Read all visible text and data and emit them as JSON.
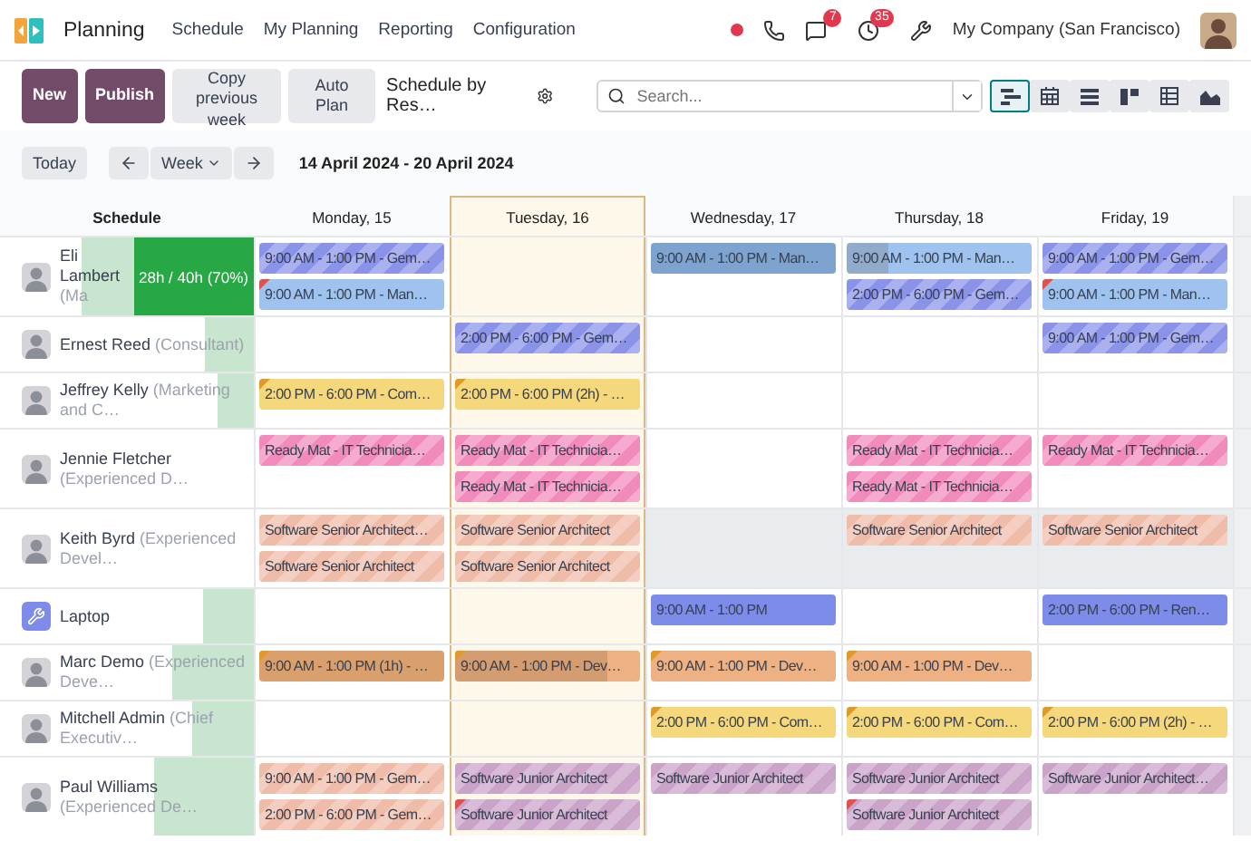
{
  "navbar": {
    "app_name": "Planning",
    "menu": [
      "Schedule",
      "My Planning",
      "Reporting",
      "Configuration"
    ],
    "chat_badge": "7",
    "activity_badge": "35",
    "company": "My Company (San Francisco)"
  },
  "toolbar": {
    "buttons": [
      {
        "label": "New",
        "kind": "primary"
      },
      {
        "label": "Publish",
        "kind": "primary"
      },
      {
        "label": "Copy previous week",
        "kind": "secondary"
      },
      {
        "label": "Auto Plan",
        "kind": "secondary"
      }
    ],
    "view_title": "Schedule by Res…",
    "search": {
      "placeholder": "Search..."
    },
    "views": [
      {
        "kind": "gantt",
        "selected": true
      },
      {
        "kind": "calendar",
        "selected": false
      },
      {
        "kind": "list",
        "selected": false
      },
      {
        "kind": "kanban",
        "selected": false
      },
      {
        "kind": "pivot",
        "selected": false
      },
      {
        "kind": "graph",
        "selected": false
      }
    ]
  },
  "date_bar": {
    "today": "Today",
    "scale": "Week",
    "range": "14 April 2024 - 20 April 2024"
  },
  "gantt": {
    "row_header": "Schedule",
    "days": [
      {
        "label": "Monday, 15",
        "today": false
      },
      {
        "label": "Tuesday, 16",
        "today": true
      },
      {
        "label": "Wednesday, 17",
        "today": false
      },
      {
        "label": "Thursday, 18",
        "today": false
      },
      {
        "label": "Friday, 19",
        "today": false
      }
    ],
    "rows": [
      {
        "name": "Eli Lambert",
        "role": "(Ma",
        "kind": "person",
        "level": 0.68,
        "workload": "28h / 40h (70%)",
        "cells": [
          {
            "unavailable": false,
            "pills": [
              {
                "text": "9:00 AM - 1:00 PM - Gem…",
                "color": "#8a93e8",
                "striped": true
              },
              {
                "text": "9:00 AM - 1:00 PM - Man…",
                "color": "#9fc3ee",
                "striped": false,
                "corner": {
                  "color": "#e0524f"
                }
              }
            ]
          },
          {
            "unavailable": false
          },
          {
            "unavailable": false,
            "pills": [
              {
                "text": "9:00 AM - 1:00 PM - Man…",
                "color": "#7fa3cf",
                "striped": false
              }
            ]
          },
          {
            "unavailable": false,
            "pills": [
              {
                "text": "9:00 AM - 1:00 PM - Man…",
                "color": "#9fc3ee",
                "striped": false,
                "level": 0.23
              },
              {
                "text": "2:00 PM - 6:00 PM - Gem…",
                "color": "#8a93e8",
                "striped": true
              }
            ]
          },
          {
            "unavailable": false,
            "pills": [
              {
                "text": "9:00 AM - 1:00 PM - Gem…",
                "color": "#8a93e8",
                "striped": true
              },
              {
                "text": "9:00 AM - 1:00 PM - Man…",
                "color": "#9fc3ee",
                "striped": false,
                "corner": {
                  "color": "#e0524f"
                }
              }
            ]
          }
        ]
      },
      {
        "name": "Ernest Reed",
        "role": "(Consultant)",
        "kind": "person",
        "level": 0.19,
        "cells": [
          {
            "unavailable": false
          },
          {
            "unavailable": false,
            "pills": [
              {
                "text": "2:00 PM - 6:00 PM - Gem…",
                "color": "#8a93e8",
                "striped": true
              }
            ]
          },
          {
            "unavailable": false
          },
          {
            "unavailable": false
          },
          {
            "unavailable": false,
            "pills": [
              {
                "text": "9:00 AM - 1:00 PM - Gem…",
                "color": "#8a93e8",
                "striped": true
              }
            ]
          }
        ]
      },
      {
        "name": "Jeffrey Kelly",
        "role": "(Marketing and C…",
        "kind": "person",
        "level": 0.14,
        "cells": [
          {
            "unavailable": false,
            "pills": [
              {
                "text": "2:00 PM - 6:00 PM - Com…",
                "color": "#f5d77c",
                "striped": false,
                "corner": {
                  "color": "#e09a2a"
                }
              }
            ]
          },
          {
            "unavailable": false,
            "pills": [
              {
                "text": "2:00 PM - 6:00 PM (2h) - …",
                "color": "#f5d77c",
                "striped": false,
                "corner": {
                  "color": "#e09a2a"
                }
              }
            ]
          },
          {
            "unavailable": false
          },
          {
            "unavailable": false
          },
          {
            "unavailable": false
          }
        ]
      },
      {
        "name": "Jennie Fletcher",
        "role": "(Experienced D…",
        "kind": "person",
        "cells": [
          {
            "unavailable": false,
            "pills": [
              {
                "text": "Ready Mat - IT Technicia…",
                "color": "#f08bbb",
                "striped": true
              }
            ]
          },
          {
            "unavailable": false,
            "pills": [
              {
                "text": "Ready Mat - IT Technicia…",
                "color": "#f08bbb",
                "striped": true
              },
              {
                "text": "Ready Mat - IT Technicia…",
                "color": "#f08bbb",
                "striped": true
              }
            ]
          },
          {
            "unavailable": false
          },
          {
            "unavailable": false,
            "pills": [
              {
                "text": "Ready Mat - IT Technicia…",
                "color": "#f08bbb",
                "striped": true
              },
              {
                "text": "Ready Mat - IT Technicia…",
                "color": "#f08bbb",
                "striped": true
              }
            ]
          },
          {
            "unavailable": false,
            "pills": [
              {
                "text": "Ready Mat - IT Technicia…",
                "color": "#f08bbb",
                "striped": true
              }
            ]
          }
        ]
      },
      {
        "name": "Keith Byrd",
        "role": "(Experienced Devel…",
        "kind": "person",
        "cells": [
          {
            "unavailable": false,
            "pills": [
              {
                "text": "Software Senior Architect…",
                "color": "#efbcaa",
                "striped": true
              },
              {
                "text": "Software Senior Architect",
                "color": "#efbcaa",
                "striped": true
              }
            ]
          },
          {
            "unavailable": false,
            "pills": [
              {
                "text": "Software Senior Architect",
                "color": "#efbcaa",
                "striped": true
              },
              {
                "text": "Software Senior Architect",
                "color": "#efbcaa",
                "striped": true
              }
            ]
          },
          {
            "unavailable": true
          },
          {
            "unavailable": true,
            "pills": [
              {
                "text": "Software Senior Architect",
                "color": "#efbcaa",
                "striped": true
              }
            ]
          },
          {
            "unavailable": true,
            "pills": [
              {
                "text": "Software Senior Architect",
                "color": "#efbcaa",
                "striped": true
              }
            ]
          }
        ]
      },
      {
        "name": "Laptop",
        "kind": "resource",
        "level": 0.2,
        "cells": [
          {
            "unavailable": false
          },
          {
            "unavailable": false
          },
          {
            "unavailable": false,
            "pills": [
              {
                "text": "9:00 AM - 1:00 PM",
                "color": "#7d8ce8",
                "striped": false
              }
            ]
          },
          {
            "unavailable": false
          },
          {
            "unavailable": false,
            "pills": [
              {
                "text": "2:00 PM - 6:00 PM - Ren…",
                "color": "#7d8ce8",
                "striped": false
              }
            ]
          }
        ]
      },
      {
        "name": "Marc Demo",
        "role": "(Experienced Deve…",
        "kind": "person",
        "level": 0.32,
        "cells": [
          {
            "unavailable": false,
            "pills": [
              {
                "text": "9:00 AM - 1:00 PM (1h) - …",
                "color": "#d9a06e",
                "striped": false,
                "corner": {
                  "color": "#e09a2a"
                }
              }
            ]
          },
          {
            "unavailable": false,
            "pills": [
              {
                "text": "9:00 AM - 1:00 PM - Dev…",
                "color": "#edb184",
                "striped": false,
                "corner": {
                  "color": "#e09a2a"
                },
                "level": 0.82
              }
            ]
          },
          {
            "unavailable": false,
            "pills": [
              {
                "text": "9:00 AM - 1:00 PM - Dev…",
                "color": "#edb184",
                "striped": false,
                "corner": {
                  "color": "#e09a2a"
                }
              }
            ]
          },
          {
            "unavailable": false,
            "pills": [
              {
                "text": "9:00 AM - 1:00 PM - Dev…",
                "color": "#edb184",
                "striped": false,
                "corner": {
                  "color": "#e09a2a"
                }
              }
            ]
          },
          {
            "unavailable": false
          }
        ]
      },
      {
        "name": "Mitchell Admin",
        "role": "(Chief Executiv…",
        "kind": "person",
        "level": 0.24,
        "cells": [
          {
            "unavailable": false
          },
          {
            "unavailable": false
          },
          {
            "unavailable": false,
            "pills": [
              {
                "text": "2:00 PM - 6:00 PM - Com…",
                "color": "#f5d77c",
                "striped": false,
                "corner": {
                  "color": "#e09a2a"
                }
              }
            ]
          },
          {
            "unavailable": false,
            "pills": [
              {
                "text": "2:00 PM - 6:00 PM - Com…",
                "color": "#f5d77c",
                "striped": false,
                "corner": {
                  "color": "#e09a2a"
                }
              }
            ]
          },
          {
            "unavailable": false,
            "pills": [
              {
                "text": "2:00 PM - 6:00 PM (2h) - …",
                "color": "#f5d77c",
                "striped": false,
                "corner": {
                  "color": "#e09a2a"
                }
              }
            ]
          }
        ]
      },
      {
        "name": "Paul Williams",
        "role": "(Experienced De…",
        "kind": "person",
        "level": 0.39,
        "cells": [
          {
            "unavailable": false,
            "pills": [
              {
                "text": "9:00 AM - 1:00 PM - Gem…",
                "color": "#efbcaa",
                "striped": true
              },
              {
                "text": "2:00 PM - 6:00 PM - Gem…",
                "color": "#efbcaa",
                "striped": true
              }
            ]
          },
          {
            "unavailable": false,
            "pills": [
              {
                "text": "Software Junior Architect",
                "color": "#c9a3c8",
                "striped": true
              },
              {
                "text": "Software Junior Architect",
                "color": "#c9a3c8",
                "striped": true,
                "corner": {
                  "color": "#e0524f"
                }
              }
            ]
          },
          {
            "unavailable": false,
            "pills": [
              {
                "text": "Software Junior Architect",
                "color": "#c9a3c8",
                "striped": true
              }
            ]
          },
          {
            "unavailable": false,
            "pills": [
              {
                "text": "Software Junior Architect",
                "color": "#c9a3c8",
                "striped": true
              },
              {
                "text": "Software Junior Architect",
                "color": "#c9a3c8",
                "striped": true,
                "corner": {
                  "color": "#e0524f"
                }
              }
            ]
          },
          {
            "unavailable": false,
            "pills": [
              {
                "text": "Software Junior Architect…",
                "color": "#c9a3c8",
                "striped": true
              }
            ]
          }
        ]
      }
    ]
  }
}
